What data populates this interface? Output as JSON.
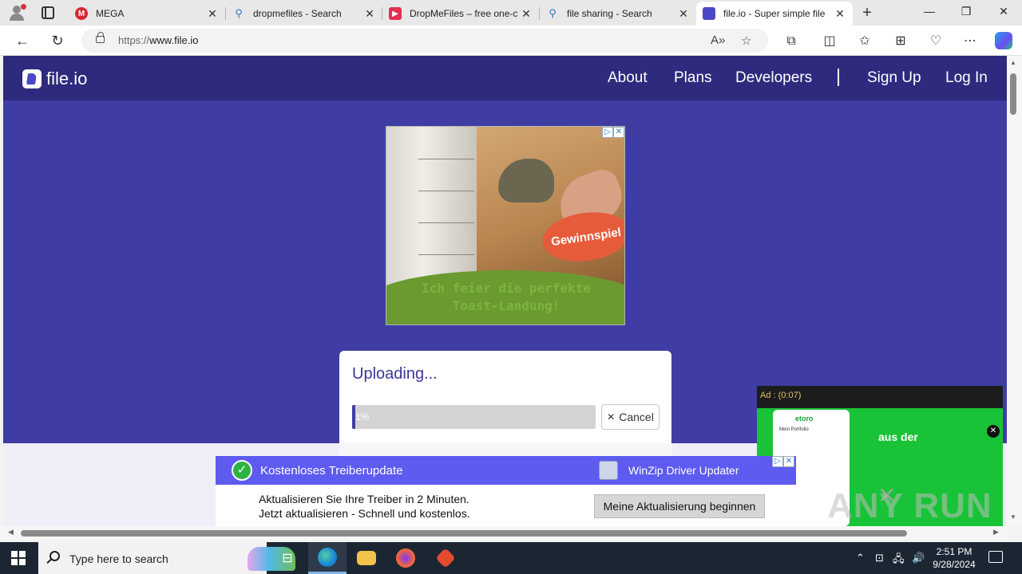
{
  "browser": {
    "tabs": [
      {
        "title": "MEGA",
        "favicon": "mega-icon",
        "color": "#d9272e",
        "glyph": "M"
      },
      {
        "title": "dropmefiles - Search",
        "favicon": "search-icon",
        "color": "#ffffff",
        "glyph": ""
      },
      {
        "title": "DropMeFiles – free one-c",
        "favicon": "dropmefiles-icon",
        "color": "#e5304f",
        "glyph": "▶"
      },
      {
        "title": "file sharing - Search",
        "favicon": "search-icon",
        "color": "#ffffff",
        "glyph": ""
      },
      {
        "title": "file.io - Super simple file",
        "favicon": "fileio-icon",
        "color": "#4b48c8",
        "glyph": ""
      }
    ],
    "active_tab": 4,
    "url_scheme": "https://",
    "url_host": "www.file.io"
  },
  "site": {
    "logo": "file.io",
    "nav": [
      "About",
      "Plans",
      "Developers",
      "Sign Up",
      "Log In"
    ]
  },
  "ad_top": {
    "burst_text": "Gewinnspiel",
    "slogan_line1": "Ich feier die perfekte",
    "slogan_line2": "Toast-Landung!"
  },
  "upload": {
    "title": "Uploading...",
    "percent_label": "1%",
    "progress": 0.01,
    "cancel_label": "Cancel"
  },
  "video_ad": {
    "label": "Ad : (0:07)",
    "brand": "etoro",
    "portfolio": "Mein Portfolio",
    "overlay_text": "aus der"
  },
  "banner": {
    "title": "Kostenloses Treiberupdate",
    "product": "WinZip Driver Updater",
    "line1": "Aktualisieren Sie Ihre Treiber in 2 Minuten.",
    "line2": "Jetzt aktualisieren - Schnell und kostenlos.",
    "cta": "Meine Aktualisierung beginnen"
  },
  "watermark": "ANY RUN",
  "taskbar": {
    "search_placeholder": "Type here to search",
    "time": "2:51 PM",
    "date": "9/28/2024"
  }
}
